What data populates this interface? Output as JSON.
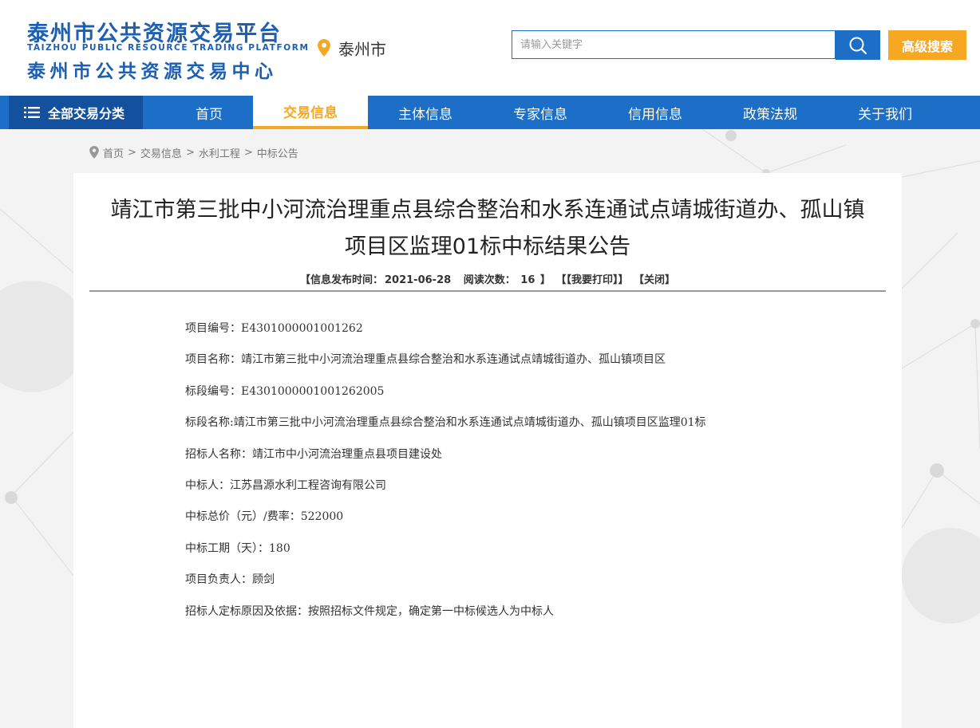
{
  "header": {
    "logo_cn_1": "泰州市公共资源交易平台",
    "logo_en": "TAIZHOU PUBLIC RESOURCE TRADING PLATFORM",
    "logo_cn_2": "泰州市公共资源交易中心",
    "location": "泰州市",
    "search_placeholder": "请输入关键字",
    "advanced_search_label": "高级搜索",
    "icons": {
      "location": "location-pin-icon",
      "search": "search-icon"
    },
    "colors": {
      "brand": "#1d6ec6",
      "accent": "#f7a823",
      "nav_dark": "#13509d"
    }
  },
  "nav": {
    "all_categories": "全部交易分类",
    "items": [
      {
        "label": "首页"
      },
      {
        "label": "交易信息",
        "active": true
      },
      {
        "label": "主体信息"
      },
      {
        "label": "专家信息"
      },
      {
        "label": "信用信息"
      },
      {
        "label": "政策法规"
      },
      {
        "label": "关于我们"
      }
    ]
  },
  "breadcrumb": {
    "items": [
      "首页",
      "交易信息",
      "水利工程",
      "中标公告"
    ],
    "separator": ">"
  },
  "article": {
    "title_line1": "靖江市第三批中小河流治理重点县综合整治和水系连通试点靖城街道办、孤山镇",
    "title_line2": "项目区监理01标中标结果公告",
    "meta": {
      "publish_label": "【信息发布时间：",
      "publish_date": "2021-06-28",
      "views_label": "阅读次数：",
      "views": "16",
      "close_bracket": "】",
      "print": "【【我要打印】】",
      "close": "【关闭】"
    },
    "fields": [
      "项目编号：E4301000001001262",
      "项目名称：靖江市第三批中小河流治理重点县综合整治和水系连通试点靖城街道办、孤山镇项目区",
      "标段编号：E4301000001001262005",
      "标段名称:靖江市第三批中小河流治理重点县综合整治和水系连通试点靖城街道办、孤山镇项目区监理01标",
      "招标人名称：靖江市中小河流治理重点县项目建设处",
      "中标人：江苏昌源水利工程咨询有限公司",
      "中标总价（元）/费率：522000",
      "中标工期（天）：180",
      "项目负责人：顾剑",
      "招标人定标原因及依据：按照招标文件规定，确定第一中标候选人为中标人"
    ]
  }
}
